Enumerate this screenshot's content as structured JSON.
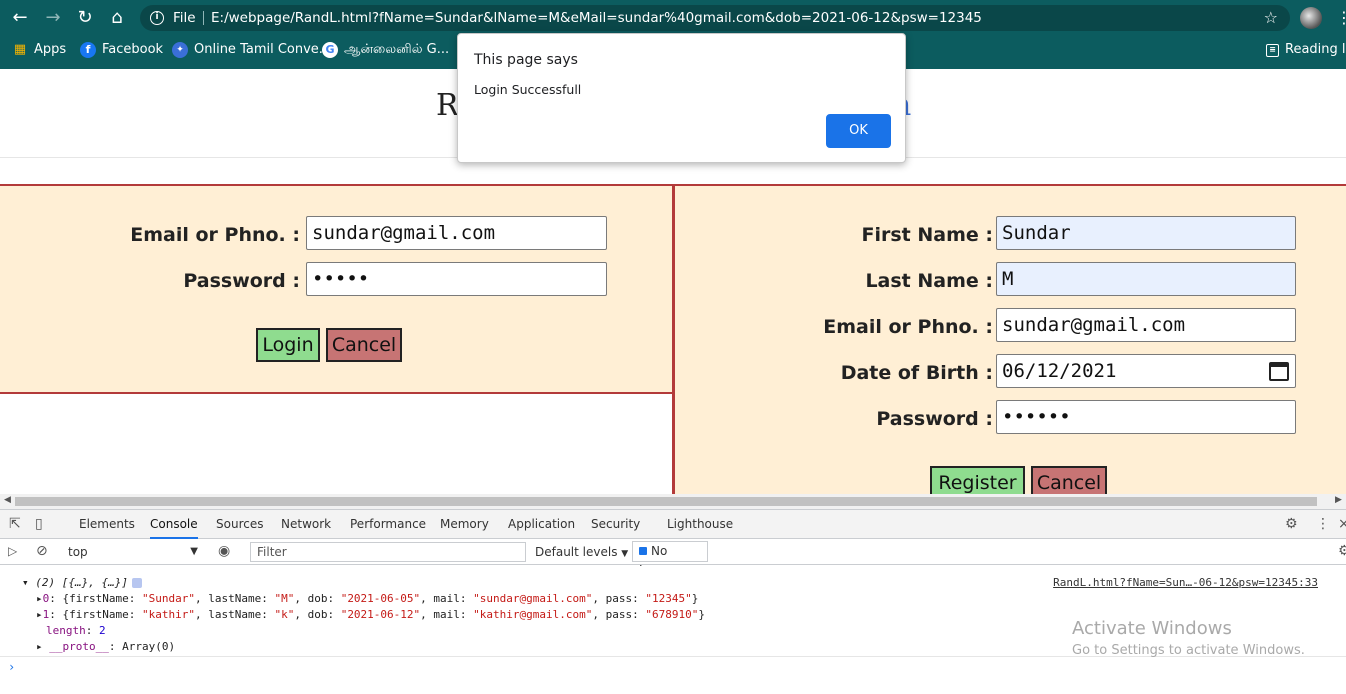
{
  "browser": {
    "address": {
      "protocol": "File",
      "url": "E:/webpage/RandL.html?fName=Sundar&lName=M&eMail=sundar%40gmail.com&dob=2021-06-12&psw=12345"
    },
    "bookmarks": [
      "Apps",
      "Facebook",
      "Online Tamil Conve...",
      "ஆன்லைனில் G...",
      "Reading list"
    ]
  },
  "page": {
    "title_start": "R",
    "title_end": "n"
  },
  "login_form": {
    "email_label": "Email or Phno. :",
    "email_value": "sundar@gmail.com",
    "password_label": "Password :",
    "password_value": "•••••",
    "login_button": "Login",
    "cancel_button": "Cancel"
  },
  "register_form": {
    "first_name_label": "First Name :",
    "first_name_value": "Sundar",
    "last_name_label": "Last Name :",
    "last_name_value": "M",
    "email_label": "Email or Phno. :",
    "email_value": "sundar@gmail.com",
    "dob_label": "Date of Birth :",
    "dob_value": "06/12/2021",
    "password_label": "Password :",
    "password_value": "••••••",
    "register_button": "Register",
    "cancel_button": "Cancel"
  },
  "dialog": {
    "title": "This page says",
    "message": "Login Successfull",
    "ok_label": "OK"
  },
  "devtools": {
    "tabs": [
      "Elements",
      "Console",
      "Sources",
      "Network",
      "Performance",
      "Memory",
      "Application",
      "Security",
      "Lighthouse"
    ],
    "active_tab": "Console",
    "context": "top",
    "filter_placeholder": "Filter",
    "levels": "Default levels",
    "issues": "No Issues",
    "console": {
      "array_header": "(2) [{…}, {…}]",
      "source": "RandL.html?fName=Sun…-06-12&psw=12345:33",
      "rows": [
        {
          "index": "0",
          "firstName": "Sundar",
          "lastName": "M",
          "dob": "2021-06-05",
          "mail": "sundar@gmail.com",
          "pass": "12345"
        },
        {
          "index": "1",
          "firstName": "kathir",
          "lastName": "k",
          "dob": "2021-06-12",
          "mail": "kathir@gmail.com",
          "pass": "678910"
        }
      ],
      "length_key": "length",
      "length_value": "2",
      "proto_key": "__proto__",
      "proto_value": "Array(0)"
    }
  },
  "watermark": {
    "line1": "Activate Windows",
    "line2": "Go to Settings to activate Windows."
  },
  "colors": {
    "chrome": "#0c5c5f",
    "panel_bg": "#ffefd5",
    "panel_border": "#b33a3a",
    "green_button": "#8fdc8f",
    "red_button": "#c77474",
    "dialog_ok": "#1a73e8"
  }
}
